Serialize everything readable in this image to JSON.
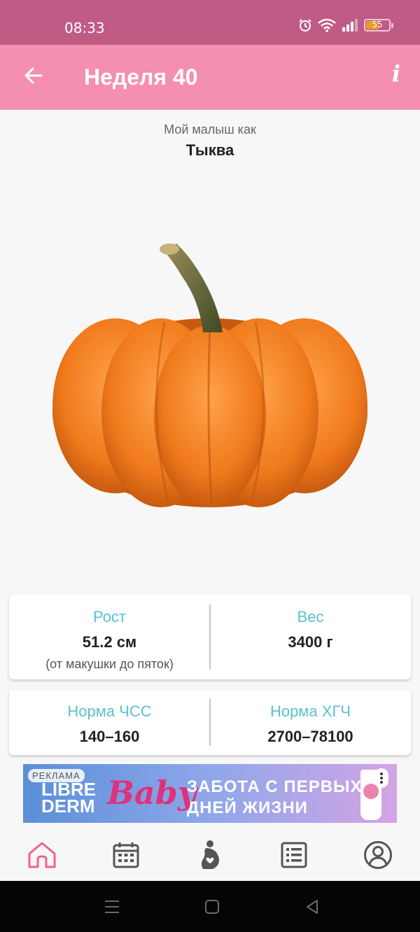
{
  "status_bar": {
    "time": "08:33",
    "battery": "55"
  },
  "header": {
    "title": "Неделя 40",
    "info_label": "i"
  },
  "size_compare": {
    "subtitle": "Мой малыш как",
    "fruit": "Тыква"
  },
  "stats_card_1": {
    "height_label": "Рост",
    "height_value": "51.2 см",
    "height_note": "(от макушки до пяток)",
    "weight_label": "Вес",
    "weight_value": "3400 г"
  },
  "stats_card_2": {
    "hr_label": "Норма ЧСС",
    "hr_value": "140–160",
    "hcg_label": "Норма ХГЧ",
    "hcg_value": "2700–78100"
  },
  "ad": {
    "tag": "РЕКЛАМА",
    "brand_line1": "LIBRE",
    "brand_line2": "DERM",
    "product": "Baby",
    "headline_line1": "ЗАБОТА С ПЕРВЫХ",
    "headline_line2": "ДНЕЙ ЖИЗНИ"
  },
  "bottom_nav": {
    "items": [
      "home-icon",
      "calendar-icon",
      "pregnancy-icon",
      "checklist-icon",
      "profile-icon"
    ],
    "active_index": 0
  },
  "colors": {
    "status_bar": "#c05b85",
    "app_bar": "#f48fb1",
    "accent_label": "#5bc0d0",
    "nav_active": "#f06292",
    "nav_inactive": "#555555"
  }
}
